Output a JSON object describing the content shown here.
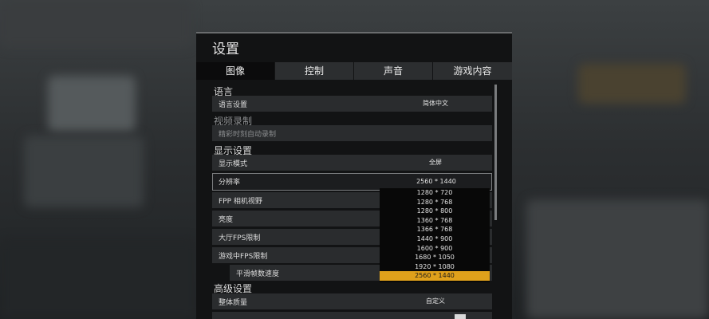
{
  "window": {
    "title": "设置"
  },
  "tabs": [
    {
      "label": "图像",
      "active": true
    },
    {
      "label": "控制",
      "active": false
    },
    {
      "label": "声音",
      "active": false
    },
    {
      "label": "游戏内容",
      "active": false
    }
  ],
  "sections": {
    "language": "语言",
    "video_recording": "视频录制",
    "display": "显示设置",
    "advanced": "高级设置"
  },
  "rows": {
    "language_setting": {
      "label": "语言设置",
      "value": "简体中文"
    },
    "highlight_recording": {
      "label": "精彩时刻自动录制"
    },
    "display_mode": {
      "label": "显示模式",
      "value": "全屏"
    },
    "resolution": {
      "label": "分辨率",
      "value": "2560 * 1440"
    },
    "fpp_fov": {
      "label": "FPP 相机视野"
    },
    "brightness": {
      "label": "亮度"
    },
    "lobby_fps": {
      "label": "大厅FPS限制"
    },
    "ingame_fps": {
      "label": "游戏中FPS限制"
    },
    "smooth_frame": {
      "label": "平滑帧数速度"
    },
    "overall_quality": {
      "label": "整体质量",
      "value": "自定义"
    }
  },
  "resolution_options": [
    "1280 * 720",
    "1280 * 768",
    "1280 * 800",
    "1360 * 768",
    "1366 * 768",
    "1440 * 900",
    "1600 * 900",
    "1680 * 1050",
    "1920 * 1080",
    "2560 * 1440"
  ],
  "resolution_selected": "2560 * 1440",
  "colors": {
    "accent": "#e0a11b",
    "panel": "#121314",
    "row": "#2a2c2e"
  }
}
